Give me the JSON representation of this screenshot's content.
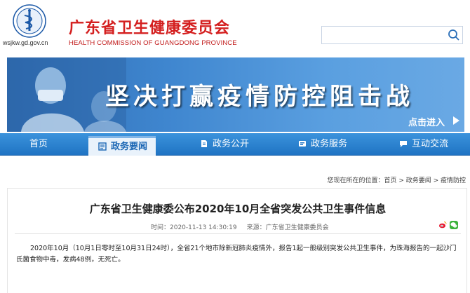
{
  "header": {
    "site_url": "wsjkw.gd.gov.cn",
    "title_cn": "广东省卫生健康委员会",
    "title_en": "HEALTH COMMISSION OF GUANGDONG PROVINCE",
    "search": {
      "value": "",
      "placeholder": "",
      "icon": "search-icon"
    },
    "logo_icon": "emblem-logo"
  },
  "banner": {
    "slogan": "坚决打赢疫情防控阻击战",
    "enter_label": "点击进入"
  },
  "nav": {
    "items": [
      {
        "label": "首页",
        "icon": ""
      },
      {
        "label": "政务要闻",
        "icon": "news-icon",
        "active": true
      },
      {
        "label": "政务公开",
        "icon": "document-icon"
      },
      {
        "label": "政务服务",
        "icon": "service-icon"
      },
      {
        "label": "互动交流",
        "icon": "chat-icon"
      }
    ]
  },
  "breadcrumb": {
    "prefix": "您现在所在的位置：",
    "path": "首页 > 政务要闻 > 疫情防控"
  },
  "article": {
    "title": "广东省卫生健康委公布2020年10月全省突发公共卫生事件信息",
    "time": "时间：2020-11-13 14:30:19",
    "source": "来源：广东省卫生健康委员会",
    "body": "2020年10月（10月1日零时至10月31日24时），全省21个地市除新冠肺炎疫情外，报告1起一般级别突发公共卫生事件，为珠海报告的一起沙门氏菌食物中毒，发病48例，无死亡。",
    "share_icons": [
      "weibo-icon",
      "wechat-icon"
    ]
  },
  "colors": {
    "brand_red": "#d42020",
    "nav_blue": "#1f73c3",
    "banner_blue": "#3f86cf"
  }
}
